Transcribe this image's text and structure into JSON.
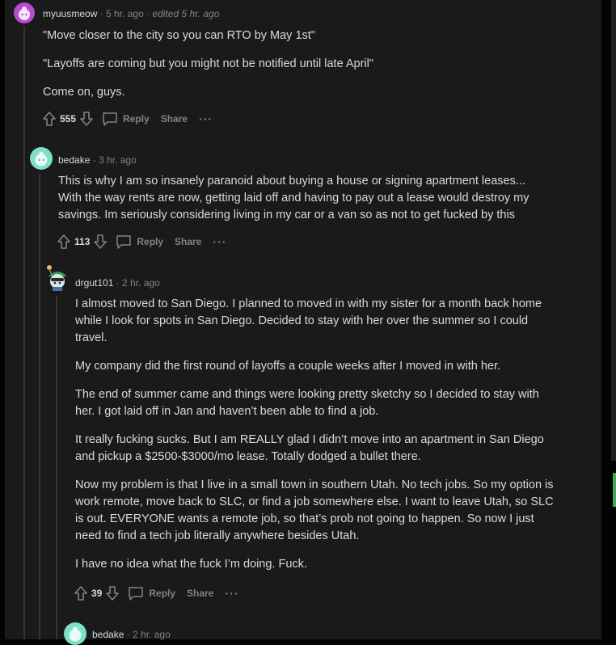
{
  "comments": [
    {
      "username": "myuusmeow",
      "time": "· 5 hr. ago",
      "edited": "· edited 5 hr. ago",
      "paragraphs": [
        "\"Move closer to the city so you can RTO by May 1st\"",
        "\"Layoffs are coming but you might not be notified until late April\"",
        "Come on, guys."
      ],
      "score": "555",
      "reply": "Reply",
      "share": "Share",
      "more": "···"
    },
    {
      "username": "bedake",
      "time": "· 3 hr. ago",
      "paragraphs": [
        "This is why I am so insanely paranoid about buying a house or signing apartment leases... With the way rents are now, getting laid off and having to pay out a lease would destroy my savings. Im seriously considering living in my car or a van so as not to get fucked by this"
      ],
      "score": "113",
      "reply": "Reply",
      "share": "Share",
      "more": "···"
    },
    {
      "username": "drgut101",
      "time": "· 2 hr. ago",
      "paragraphs": [
        "I almost moved to San Diego. I planned to moved in with my sister for a month back home while I look for spots in San Diego. Decided to stay with her over the summer so I could travel.",
        "My company did the first round of layoffs a couple weeks after I moved in with her.",
        "The end of summer came and things were looking pretty sketchy so I decided to stay with her. I got laid off in Jan and haven’t been able to find a job.",
        "It really fucking sucks. But I am REALLY glad I didn’t move into an apartment in San Diego and pickup a $2500-$3000/mo lease. Totally dodged a bullet there.",
        "Now my problem is that I live in a small town in southern Utah. No tech jobs. So my option is work remote, move back to SLC, or find a job somewhere else. I want to leave Utah, so SLC is out. EVERYONE wants a remote job, so that’s prob not going to happen. So now I just need to find a tech job literally anywhere besides Utah.",
        "I have no idea what the fuck I’m doing. Fuck."
      ],
      "score": "39",
      "reply": "Reply",
      "share": "Share",
      "more": "···"
    },
    {
      "username": "bedake",
      "time": "· 2 hr. ago"
    }
  ],
  "colors": {
    "background": "#1a1a1b",
    "text": "#d7dadc",
    "meta": "#818384",
    "avatar_purple": "#b84cd0",
    "avatar_teal": "#7fe0c8",
    "scroll_accent": "#46a758"
  }
}
